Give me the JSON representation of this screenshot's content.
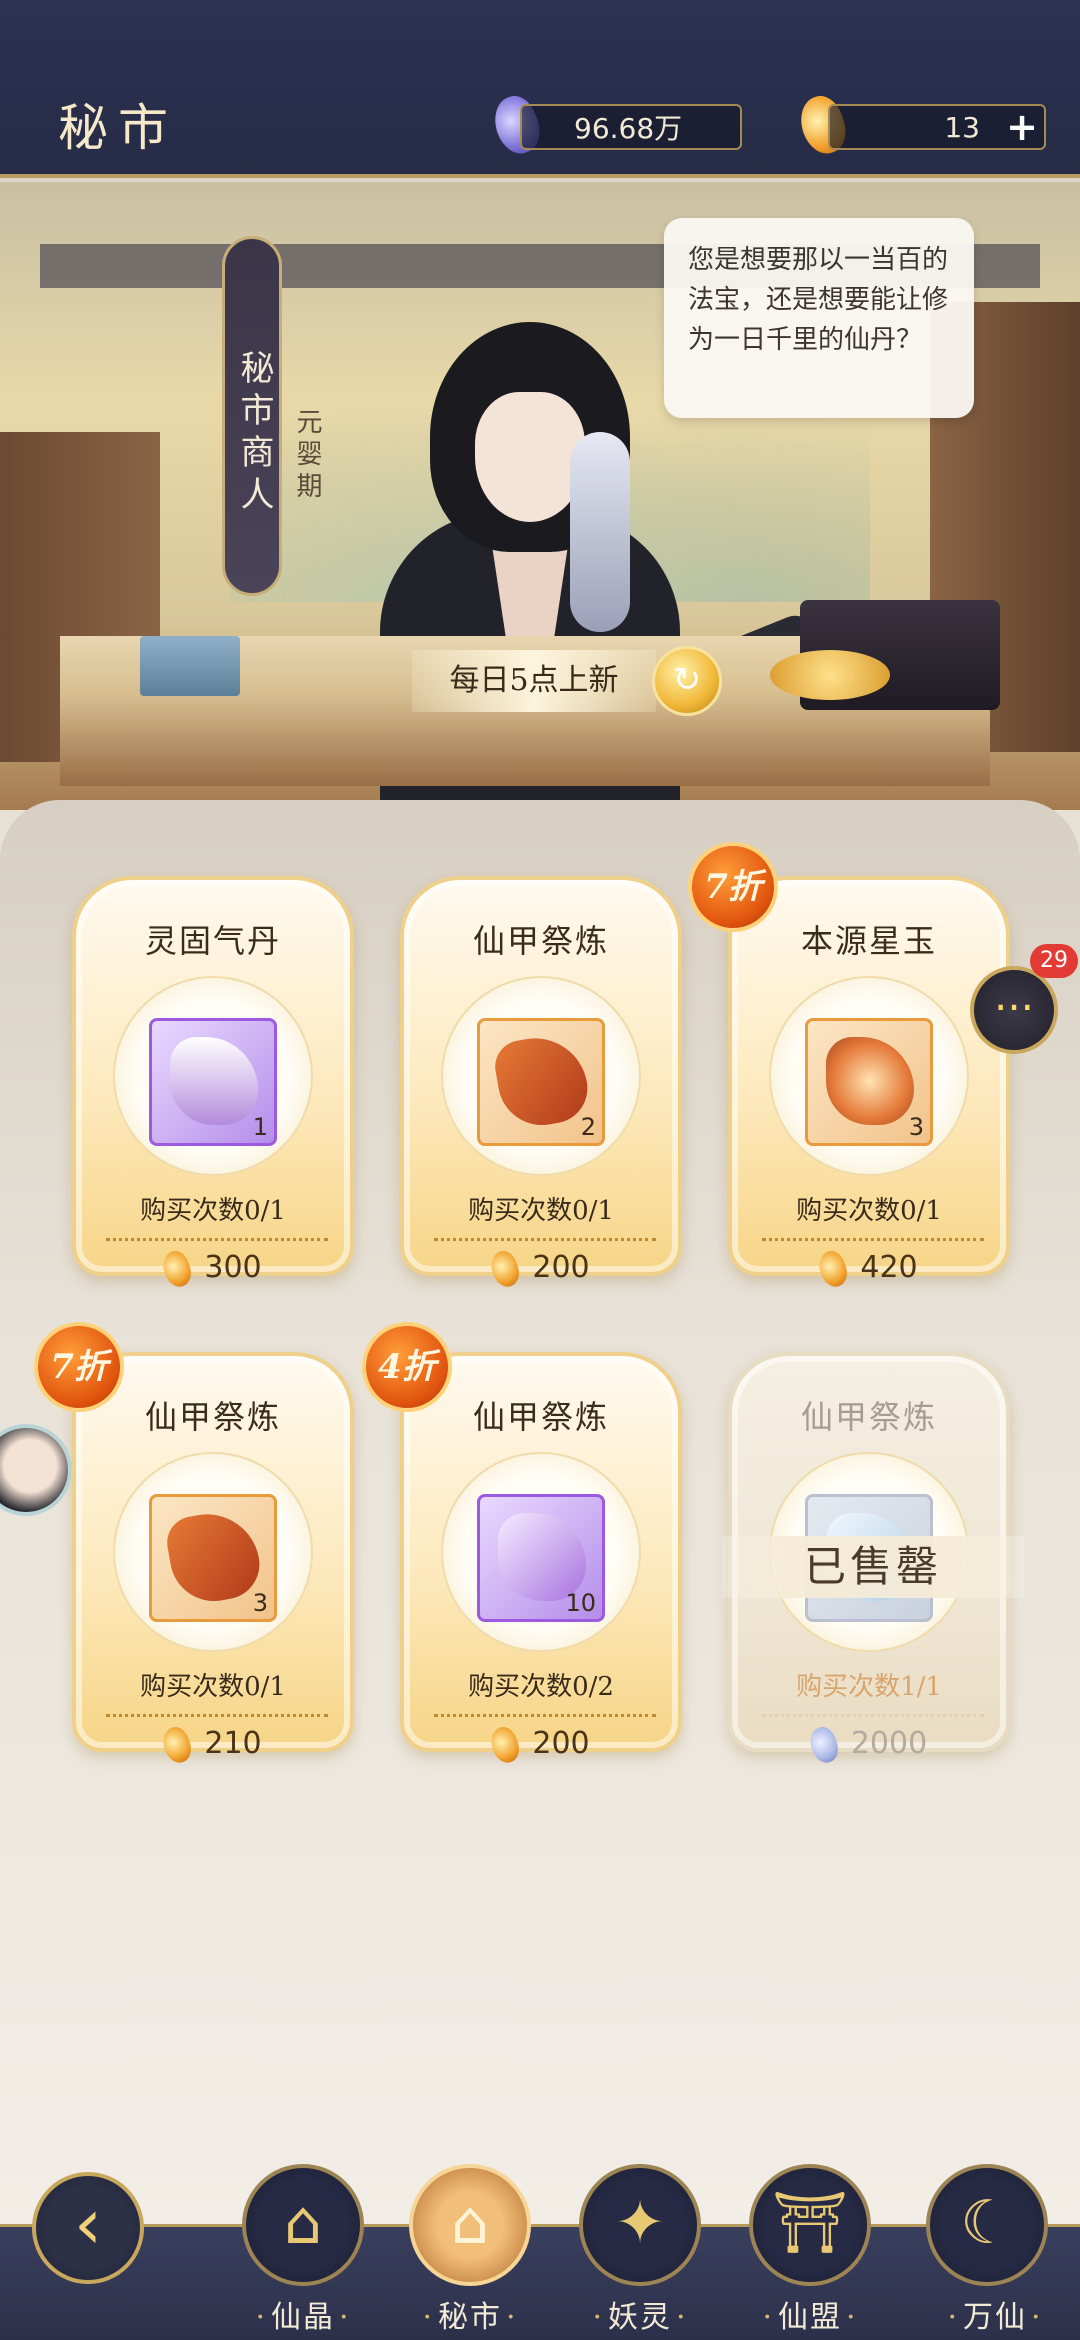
{
  "header": {
    "title": "秘市",
    "jade_amount": "96.68万",
    "gold_amount": "13",
    "plus_label": "+",
    "icons": {
      "jade": "spirit-jade-icon",
      "gold": "spirit-flame-icon"
    }
  },
  "scene": {
    "npc_name": "秘市商人",
    "npc_rank": "元婴期",
    "dialogue": "您是想要那以一当百的法宝，还是想要能让修为一日千里的仙丹？",
    "refresh_text": "每日5点上新"
  },
  "items": [
    {
      "name": "灵固气丹",
      "qty": "1",
      "limit": "购买次数0/1",
      "price": "300",
      "discount": "",
      "sold": false,
      "rarity": "purple",
      "icon": "pill-vial-icon"
    },
    {
      "name": "仙甲祭炼",
      "qty": "2",
      "limit": "购买次数0/1",
      "price": "200",
      "discount": "",
      "sold": false,
      "rarity": "orange",
      "icon": "red-scroll-icon"
    },
    {
      "name": "本源星玉",
      "qty": "3",
      "limit": "购买次数0/1",
      "price": "420",
      "discount": "7折",
      "sold": false,
      "rarity": "orange",
      "icon": "star-jade-icon"
    },
    {
      "name": "仙甲祭炼",
      "qty": "3",
      "limit": "购买次数0/1",
      "price": "210",
      "discount": "7折",
      "sold": false,
      "rarity": "orange",
      "icon": "red-scroll-icon"
    },
    {
      "name": "仙甲祭炼",
      "qty": "10",
      "limit": "购买次数0/2",
      "price": "200",
      "discount": "4折",
      "sold": false,
      "rarity": "purple",
      "icon": "purple-scroll-icon"
    },
    {
      "name": "仙甲祭炼",
      "qty": "",
      "limit": "购买次数1/1",
      "price": "2000",
      "discount": "",
      "sold": true,
      "sold_label": "已售罄",
      "rarity": "grey",
      "icon": "blue-scroll-icon"
    }
  ],
  "chat": {
    "badge": "29",
    "icon": "chat-bubble-icon"
  },
  "nav": {
    "back_icon": "back-arrow-icon",
    "items": [
      {
        "label": "仙晶",
        "icon": "pavilion-icon"
      },
      {
        "label": "秘市",
        "icon": "market-icon",
        "active": true
      },
      {
        "label": "妖灵",
        "icon": "beast-icon"
      },
      {
        "label": "仙盟",
        "icon": "gate-icon"
      },
      {
        "label": "万仙",
        "icon": "immortal-icon"
      }
    ]
  }
}
